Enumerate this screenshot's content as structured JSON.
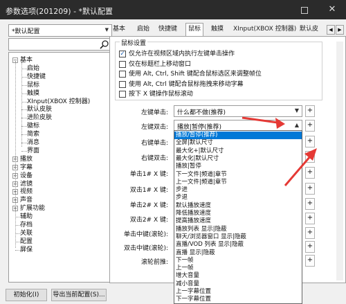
{
  "window": {
    "title": "参数选项(201209) - *默认配置",
    "close_label": "✕"
  },
  "left": {
    "preset_value": "*默认配置",
    "tree": [
      {
        "label": "基本",
        "level": 0,
        "expanded": true
      },
      {
        "label": "启始",
        "level": 1
      },
      {
        "label": "快捷键",
        "level": 1
      },
      {
        "label": "鼠标",
        "level": 1
      },
      {
        "label": "触摸",
        "level": 1
      },
      {
        "label": "XInput(XBOX 控制器)",
        "level": 1
      },
      {
        "label": "默认皮肤",
        "level": 1
      },
      {
        "label": "进阶皮肤",
        "level": 1
      },
      {
        "label": "徽标",
        "level": 1
      },
      {
        "label": "简索",
        "level": 1
      },
      {
        "label": "消息",
        "level": 1
      },
      {
        "label": "界面",
        "level": 1
      },
      {
        "label": "播放",
        "level": 0,
        "expanded": false
      },
      {
        "label": "字幕",
        "level": 0,
        "expanded": false
      },
      {
        "label": "设备",
        "level": 0,
        "expanded": false
      },
      {
        "label": "滤镜",
        "level": 0,
        "expanded": false
      },
      {
        "label": "视频",
        "level": 0,
        "expanded": false
      },
      {
        "label": "声音",
        "level": 0,
        "expanded": false
      },
      {
        "label": "扩展功能",
        "level": 0,
        "expanded": false
      },
      {
        "label": "辅助",
        "level": 0
      },
      {
        "label": "存档",
        "level": 0
      },
      {
        "label": "关联",
        "level": 0
      },
      {
        "label": "配置",
        "level": 0
      },
      {
        "label": "屏保",
        "level": 0
      }
    ]
  },
  "tabs": [
    "基本",
    "启始",
    "快捷键",
    "鼠标",
    "触摸",
    "XInput(XBOX 控制器)",
    "默认皮"
  ],
  "active_tab": "鼠标",
  "mouse": {
    "group_title": "鼠标设置",
    "checkboxes": [
      {
        "label": "仅允许在视频区域内执行左键单击操作",
        "checked": true
      },
      {
        "label": "仅在标题栏上移动窗口",
        "checked": false
      },
      {
        "label": "使用 Alt, Ctrl, Shift 键配合鼠标选区来调整帧位",
        "checked": false
      },
      {
        "label": "使用 Alt, Ctrl 键配合鼠标拖拽来移动字幕",
        "checked": false
      },
      {
        "label": "按下 X 键操作鼠标滚动",
        "checked": false
      }
    ],
    "rows": [
      {
        "label": "左键单击:",
        "value": "什么都不做(推荐)"
      },
      {
        "label": "左键双击:",
        "value": "播放|暂停(推荐)"
      },
      {
        "label": "右键单击:",
        "value": ""
      },
      {
        "label": "右键双击:",
        "value": ""
      },
      {
        "label": "单击1# X 键:",
        "value": ""
      },
      {
        "label": "双击1# X 键:",
        "value": ""
      },
      {
        "label": "单击2# X 键:",
        "value": ""
      },
      {
        "label": "双击2# X 键:",
        "value": ""
      },
      {
        "label": "单击中键(滚轮):",
        "value": ""
      },
      {
        "label": "双击中键(滚轮):",
        "value": ""
      },
      {
        "label": "滚轮前推:",
        "value": ""
      }
    ],
    "plus_label": "+"
  },
  "dropdown_items": [
    "播放/暂停(推荐)",
    "全屏|默认尺寸",
    "最大化+|默认尺寸",
    "最大化|默认尺寸",
    "播放|暂停",
    "下一文件|频道|章节",
    "上一文件|频道|章节",
    "步进",
    "步退",
    "默认播放速度",
    "降低播放速度",
    "提高播放速度",
    "播放列表 显示|隐蔽",
    "聊天/浏览器窗口 显示|隐蔽",
    "直播/VOD 列表 显示|隐蔽",
    "直播 显示|隐蔽",
    "下一帧",
    "上一帧",
    "增大音量",
    "减小音量",
    "上一字幕位置",
    "下一字幕位置"
  ],
  "bottom": {
    "init_label": "初始化(I)",
    "export_label": "导出当前配置(S)..."
  },
  "colors": {
    "accent": "#0078d7",
    "arrow": "#e53935"
  }
}
